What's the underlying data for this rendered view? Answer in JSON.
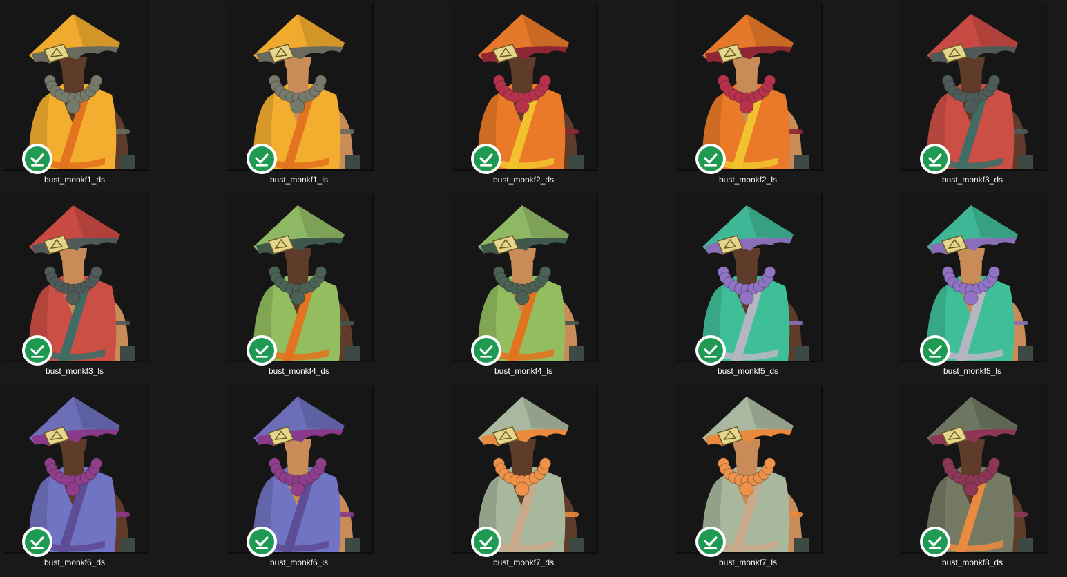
{
  "window": {
    "background": "#191919"
  },
  "status_icon": "sync-complete-check-icon",
  "files": [
    {
      "name": "bust_monkf1_ds",
      "hat": "#f0aa2e",
      "trim": "#6b6a5e",
      "robe": "#f3ad2f",
      "sash": "#e2731f",
      "beads": "#767a6a",
      "skin": "#5e3c29"
    },
    {
      "name": "bust_monkf1_ls",
      "hat": "#f0aa2e",
      "trim": "#6b6a5e",
      "robe": "#f3ad2f",
      "sash": "#e2731f",
      "beads": "#767a6a",
      "skin": "#c98c58"
    },
    {
      "name": "bust_monkf2_ds",
      "hat": "#e5782a",
      "trim": "#8e2634",
      "robe": "#ea7a27",
      "sash": "#f2c22e",
      "beads": "#b8314a",
      "skin": "#5e3c29"
    },
    {
      "name": "bust_monkf2_ls",
      "hat": "#e5782a",
      "trim": "#8e2634",
      "robe": "#ea7a27",
      "sash": "#f2c22e",
      "beads": "#b8314a",
      "skin": "#c98c58"
    },
    {
      "name": "bust_monkf3_ds",
      "hat": "#c84a42",
      "trim": "#4f5a58",
      "robe": "#cc4f45",
      "sash": "#3f6d66",
      "beads": "#4f5b59",
      "skin": "#5e3c29"
    },
    {
      "name": "bust_monkf3_ls",
      "hat": "#c84a42",
      "trim": "#4f5a58",
      "robe": "#cc4f45",
      "sash": "#3f6d66",
      "beads": "#4f5b59",
      "skin": "#c98c58"
    },
    {
      "name": "bust_monkf4_ds",
      "hat": "#8fb864",
      "trim": "#40574c",
      "robe": "#93bd5f",
      "sash": "#e2731f",
      "beads": "#4a6154",
      "skin": "#5e3c29"
    },
    {
      "name": "bust_monkf4_ls",
      "hat": "#8fb864",
      "trim": "#40574c",
      "robe": "#93bd5f",
      "sash": "#e2731f",
      "beads": "#4a6154",
      "skin": "#c98c58"
    },
    {
      "name": "bust_monkf5_ds",
      "hat": "#3fb796",
      "trim": "#8a6fb8",
      "robe": "#3fbf98",
      "sash": "#b6b6c2",
      "beads": "#9073c4",
      "skin": "#5e3c29"
    },
    {
      "name": "bust_monkf5_ls",
      "hat": "#3fb796",
      "trim": "#8a6fb8",
      "robe": "#3fbf98",
      "sash": "#b6b6c2",
      "beads": "#9073c4",
      "skin": "#c98c58"
    },
    {
      "name": "bust_monkf6_ds",
      "hat": "#6c6fb8",
      "trim": "#8a3a8c",
      "robe": "#7174c2",
      "sash": "#5e4d96",
      "beads": "#8e3e8a",
      "skin": "#5e3c29"
    },
    {
      "name": "bust_monkf6_ls",
      "hat": "#6c6fb8",
      "trim": "#8a3a8c",
      "robe": "#7174c2",
      "sash": "#5e4d96",
      "beads": "#8e3e8a",
      "skin": "#c98c58"
    },
    {
      "name": "bust_monkf7_ds",
      "hat": "#a9b89e",
      "trim": "#e98a3e",
      "robe": "#a8b89c",
      "sash": "#c9a98a",
      "beads": "#f0914a",
      "skin": "#5e3c29"
    },
    {
      "name": "bust_monkf7_ls",
      "hat": "#a9b89e",
      "trim": "#e98a3e",
      "robe": "#a8b89c",
      "sash": "#c9a98a",
      "beads": "#f0914a",
      "skin": "#c98c58"
    },
    {
      "name": "bust_monkf8_ds",
      "hat": "#6e7560",
      "trim": "#8e3656",
      "robe": "#747a64",
      "sash": "#e98a3e",
      "beads": "#8e3656",
      "skin": "#5e3c29"
    }
  ]
}
